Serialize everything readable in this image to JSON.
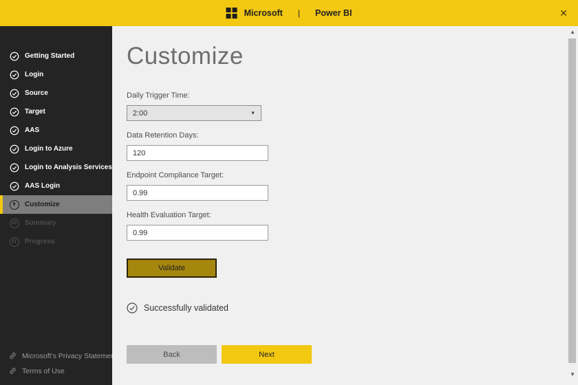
{
  "header": {
    "brand": "Microsoft",
    "separator": "|",
    "product": "Power BI"
  },
  "sidebar": {
    "steps": [
      {
        "label": "Getting Started",
        "state": "completed"
      },
      {
        "label": "Login",
        "state": "completed"
      },
      {
        "label": "Source",
        "state": "completed"
      },
      {
        "label": "Target",
        "state": "completed"
      },
      {
        "label": "AAS",
        "state": "completed"
      },
      {
        "label": "Login to Azure",
        "state": "completed"
      },
      {
        "label": "Login to Analysis Services",
        "state": "completed"
      },
      {
        "label": "AAS Login",
        "state": "completed"
      },
      {
        "label": "Customize",
        "state": "current",
        "number": "9"
      },
      {
        "label": "Summary",
        "state": "pending",
        "number": "10"
      },
      {
        "label": "Progress",
        "state": "pending",
        "number": "11"
      }
    ],
    "footer_links": [
      {
        "label": "Microsoft's Privacy Statement"
      },
      {
        "label": "Terms of Use"
      }
    ]
  },
  "main": {
    "title": "Customize",
    "fields": [
      {
        "label": "Daily Trigger Time:",
        "value": "2:00",
        "type": "select"
      },
      {
        "label": "Data Retention Days:",
        "value": "120",
        "type": "text"
      },
      {
        "label": "Endpoint Compliance Target:",
        "value": "0.99",
        "type": "text"
      },
      {
        "label": "Health Evaluation Target:",
        "value": "0.99",
        "type": "text"
      }
    ],
    "validate_label": "Validate",
    "status_message": "Successfully validated",
    "back_label": "Back",
    "next_label": "Next"
  },
  "icons": {
    "close": "✕",
    "dropdown_arrow": "▼",
    "scroll_up": "▲",
    "scroll_down": "▼"
  },
  "colors": {
    "brand_yellow": "#F2C811",
    "sidebar_bg": "#242424",
    "main_bg": "#F0F0F0",
    "validate_bg": "#A5870E",
    "selected_step_bg": "#7E7E7E"
  }
}
